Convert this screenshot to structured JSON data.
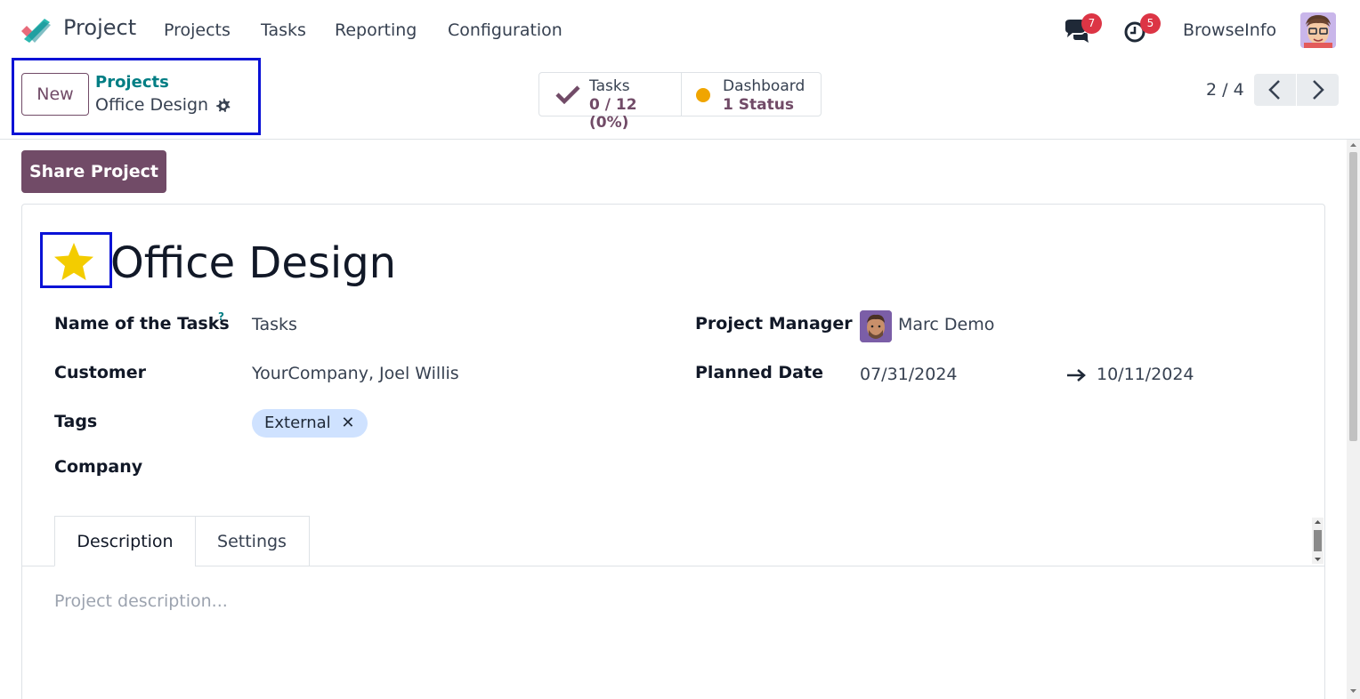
{
  "navbar": {
    "app_name": "Project",
    "menu": [
      "Projects",
      "Tasks",
      "Reporting",
      "Configuration"
    ],
    "messages_count": "7",
    "activities_count": "5",
    "username": "BrowseInfo"
  },
  "control_panel": {
    "new_label": "New",
    "breadcrumb_parent": "Projects",
    "breadcrumb_current": "Office Design",
    "tasks_stat": {
      "label": "Tasks",
      "value": "0 / 12 (0%)"
    },
    "dashboard_stat": {
      "label": "Dashboard",
      "value": "1 Status"
    },
    "pager": "2 / 4"
  },
  "form": {
    "share_label": "Share Project",
    "title": "Office Design",
    "is_favorite": true,
    "fields": {
      "tasks_name_label": "Name of the Tasks",
      "tasks_name_help": "?",
      "tasks_name_value": "Tasks",
      "customer_label": "Customer",
      "customer_value": "YourCompany, Joel Willis",
      "tags_label": "Tags",
      "tags": [
        "External"
      ],
      "company_label": "Company",
      "company_value": "",
      "manager_label": "Project Manager",
      "manager_value": "Marc Demo",
      "planned_label": "Planned Date",
      "planned_start": "07/31/2024",
      "planned_end": "10/11/2024"
    },
    "tabs": [
      "Description",
      "Settings"
    ],
    "description_placeholder": "Project description..."
  },
  "colors": {
    "primary": "#714b67",
    "link": "#017e84",
    "highlight": "#0a12d6",
    "star": "#f3cc00",
    "badge": "#dc3545",
    "status_dot": "#f0a500"
  }
}
